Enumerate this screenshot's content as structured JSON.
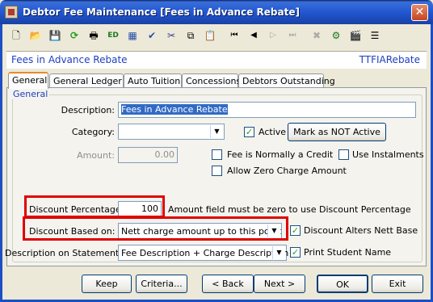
{
  "window": {
    "title": "Debtor Fee Maintenance  [Fees in Advance Rebate]",
    "close_glyph": "✕"
  },
  "toolbar": {
    "items": [
      {
        "name": "new-icon",
        "glyph": "🗋"
      },
      {
        "name": "open-folder-icon",
        "glyph": "📂"
      },
      {
        "name": "save-icon",
        "glyph": "💾"
      },
      {
        "name": "refresh-icon",
        "glyph": "⟳"
      },
      {
        "name": "print-icon",
        "glyph": "🖶"
      },
      {
        "name": "edit-icon",
        "glyph": "ED"
      },
      {
        "name": "calculator-icon",
        "glyph": "▦"
      },
      {
        "name": "spellcheck-icon",
        "glyph": "✔"
      },
      {
        "name": "cut-icon",
        "glyph": "✂"
      },
      {
        "name": "copy-icon",
        "glyph": "⧉"
      },
      {
        "name": "paste-icon",
        "glyph": "📋"
      },
      {
        "name": "first-record-icon",
        "glyph": "⏮"
      },
      {
        "name": "previous-record-icon",
        "glyph": "◀"
      },
      {
        "name": "next-record-icon",
        "glyph": "▷"
      },
      {
        "name": "last-record-icon",
        "glyph": "⏭"
      },
      {
        "name": "delete-icon",
        "glyph": "✖"
      },
      {
        "name": "tree-icon",
        "glyph": "⚙"
      },
      {
        "name": "clapper-icon",
        "glyph": "🎬"
      },
      {
        "name": "list-icon",
        "glyph": "☰"
      }
    ]
  },
  "header": {
    "left": "Fees in Advance Rebate",
    "right": "TTFIARebate"
  },
  "tabs": [
    "General",
    "General Ledger",
    "Auto Tuition",
    "Concessions",
    "Debtors Outstanding"
  ],
  "group_label": "General",
  "form": {
    "description_label": "Description:",
    "description_value": "Fees in Advance Rebate",
    "category_label": "Category:",
    "category_value": "",
    "active_label": "Active",
    "mark_not_active": "Mark as NOT Active",
    "amount_label": "Amount:",
    "amount_value": "0.00",
    "fee_credit_label": "Fee is Normally a Credit",
    "use_instalments_label": "Use Instalments",
    "allow_zero_label": "Allow Zero Charge Amount",
    "discount_pct_label": "Discount Percentage:",
    "discount_pct_value": "100",
    "discount_note": "Amount field must be zero to use Discount Percentage",
    "discount_based_label": "Discount Based on:",
    "discount_based_value": "Nett charge amount up to this point",
    "discount_alters_label": "Discount Alters Nett Base",
    "desc_statement_label": "Description on Statement:",
    "desc_statement_value": "Fee Description + Charge Description",
    "print_student_label": "Print Student Name",
    "check_glyph": "✓",
    "dropdown_glyph": "▼"
  },
  "buttons": {
    "keep": "Keep",
    "criteria": "Criteria...",
    "back": "< Back",
    "next": "Next >",
    "ok": "OK",
    "exit": "Exit"
  },
  "colors": {
    "highlight_box": "#e00000",
    "header_text": "#1f3fbf"
  }
}
